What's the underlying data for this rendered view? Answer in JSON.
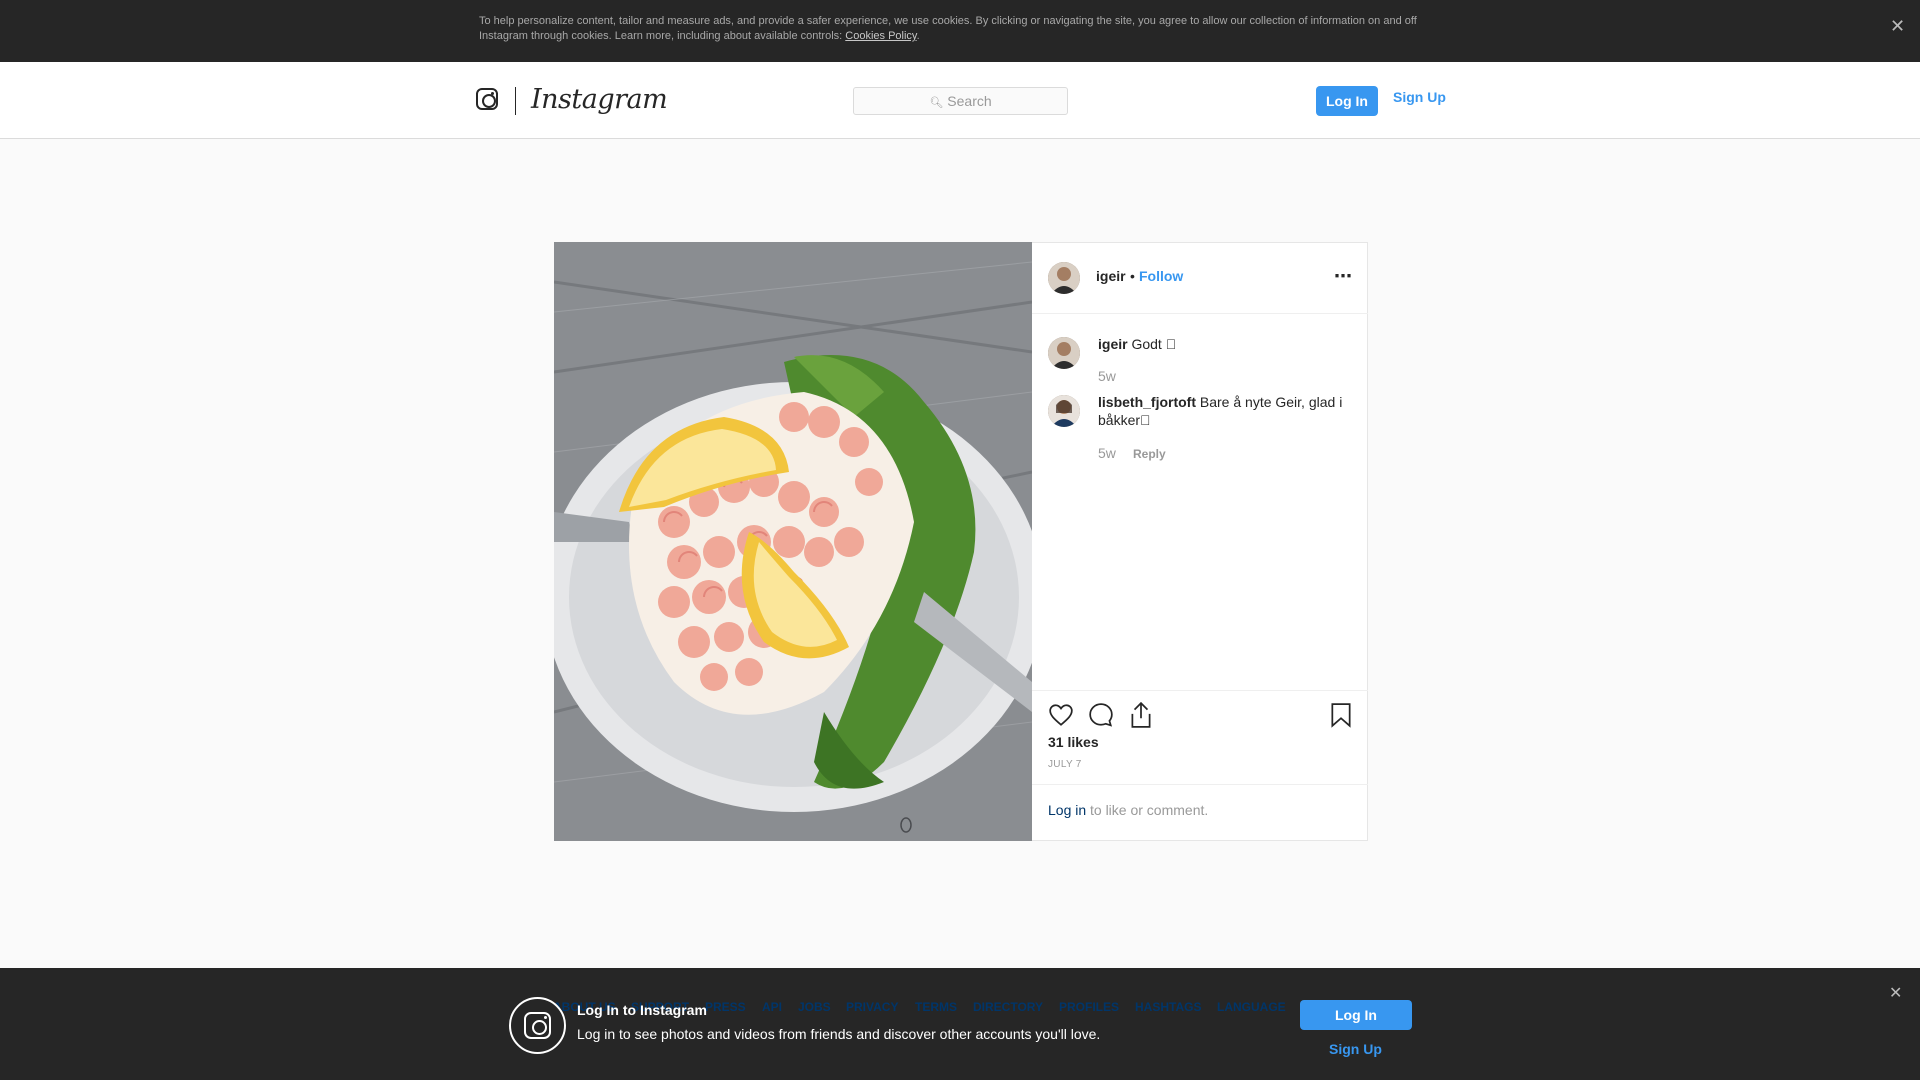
{
  "cookie_banner": {
    "text": "To help personalize content, tailor and measure ads, and provide a safer experience, we use cookies. By clicking or navigating the site, you agree to allow our collection of information on and off Instagram through cookies. Learn more, including about available controls:",
    "policy_link": "Cookies Policy",
    "close_icon": "close-icon"
  },
  "header": {
    "wordmark": "Instagram",
    "search_placeholder": "Search",
    "login_label": "Log In",
    "signup_label": "Sign Up"
  },
  "post": {
    "author": "igeir",
    "separator": "•",
    "follow_label": "Follow",
    "more_icon": "more-options-icon",
    "comments": [
      {
        "user": "igeir",
        "text": "Godt \u0000",
        "time": "5w",
        "reply": ""
      },
      {
        "user": "lisbeth_fjortoft",
        "text": "Bare å nyte Geir, glad i båkker\u0000",
        "time": "5w",
        "reply": "Reply"
      }
    ],
    "likes": "31 likes",
    "date": "JULY 7",
    "login_link": "Log in",
    "login_rest": "to like or comment."
  },
  "footer_links": [
    "ABOUT US",
    "SUPPORT",
    "PRESS",
    "API",
    "JOBS",
    "PRIVACY",
    "TERMS",
    "DIRECTORY",
    "PROFILES",
    "HASHTAGS",
    "LANGUAGE"
  ],
  "login_prompt": {
    "title": "Log In to Instagram",
    "subtitle": "Log in to see photos and videos from friends and discover other accounts you'll love.",
    "login_label": "Log In",
    "signup_label": "Sign Up"
  },
  "colors": {
    "accent": "#3897f0",
    "dark_banner": "#262626",
    "background": "#fafafa"
  }
}
